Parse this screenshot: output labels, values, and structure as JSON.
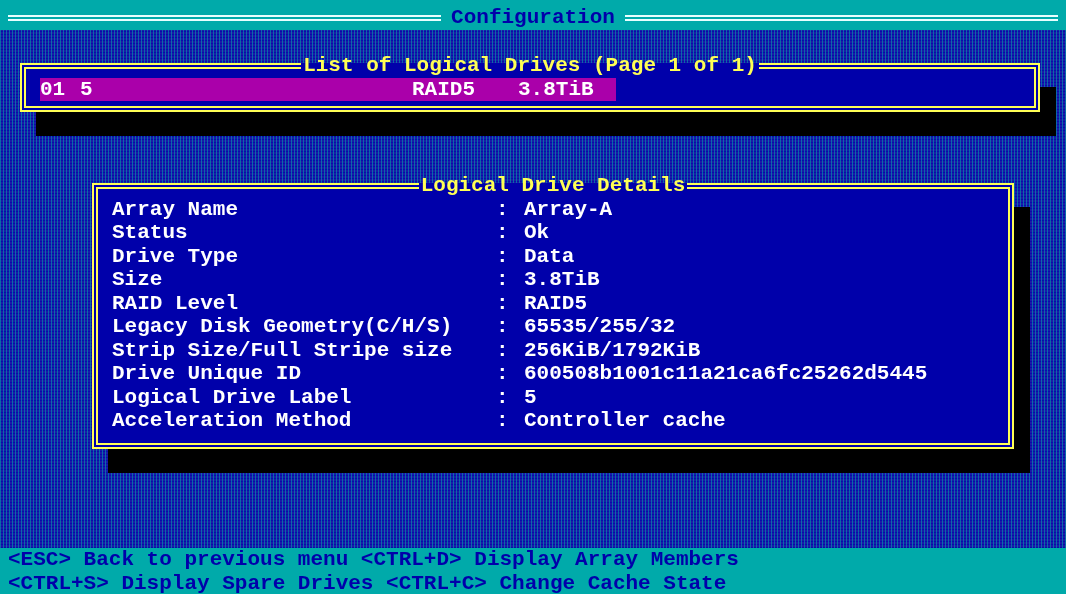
{
  "title": "Configuration",
  "drive_list": {
    "title": "List of Logical Drives (Page 1 of 1)",
    "rows": [
      {
        "number": "01",
        "label": "5",
        "raid_level": "RAID5",
        "size": "3.8TiB",
        "selected": true
      }
    ]
  },
  "details": {
    "title": "Logical Drive Details",
    "fields": [
      {
        "label": "Array Name",
        "separator": ":",
        "value": "Array-A"
      },
      {
        "label": "Status",
        "separator": ":",
        "value": "Ok"
      },
      {
        "label": "Drive Type",
        "separator": ":",
        "value": "Data"
      },
      {
        "label": "Size",
        "separator": ":",
        "value": "3.8TiB"
      },
      {
        "label": "RAID Level",
        "separator": ":",
        "value": "RAID5"
      },
      {
        "label": "Legacy Disk Geometry(C/H/S)",
        "separator": ":",
        "value": "65535/255/32"
      },
      {
        "label": "Strip Size/Full Stripe size",
        "separator": ":",
        "value": "256KiB/1792KiB"
      },
      {
        "label": "Drive Unique ID",
        "separator": ":",
        "value": "600508b1001c11a21ca6fc25262d5445"
      },
      {
        "label": "Logical Drive Label",
        "separator": ":",
        "value": "5"
      },
      {
        "label": "Acceleration Method",
        "separator": ":",
        "value": "Controller cache"
      }
    ]
  },
  "footer": [
    "<ESC> Back to previous menu <CTRL+D> Display Array Members",
    "<CTRL+S> Display Spare Drives <CTRL+C> Change Cache State"
  ]
}
